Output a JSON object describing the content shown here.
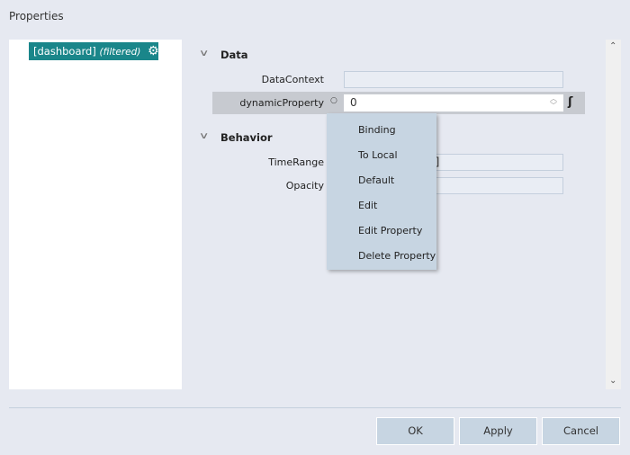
{
  "window": {
    "title": "Properties"
  },
  "tree": {
    "node_label": "[dashboard]",
    "node_filter": "(filtered)",
    "node_icon": "gear-icon"
  },
  "sections": [
    {
      "title": "Data",
      "properties": [
        {
          "label": "DataContext",
          "value": ""
        },
        {
          "label": "dynamicProperty",
          "value": "0"
        }
      ]
    },
    {
      "title": "Behavior",
      "properties": [
        {
          "label": "TimeRange",
          "value": "o [now]"
        },
        {
          "label": "Opacity",
          "value": ""
        }
      ]
    }
  ],
  "context_menu": {
    "items": [
      "Binding",
      "To Local",
      "Default",
      "Edit",
      "Edit Property",
      "Delete Property"
    ]
  },
  "buttons": {
    "ok": "OK",
    "apply": "Apply",
    "cancel": "Cancel"
  },
  "colors": {
    "accent": "#1a868a",
    "menu": "#c7d5e2",
    "background": "#e6e9f1"
  }
}
